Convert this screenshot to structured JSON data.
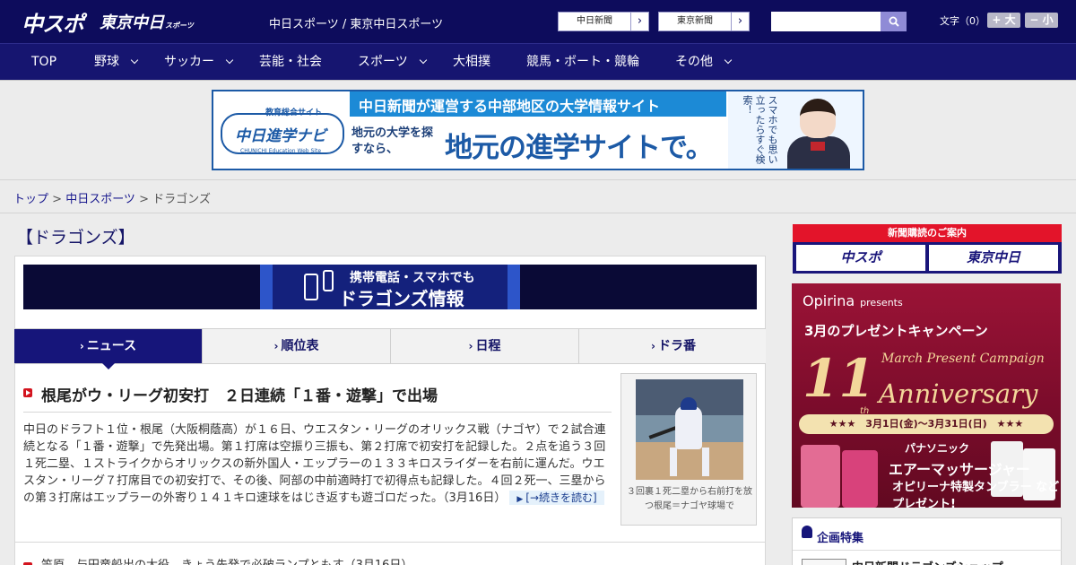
{
  "header": {
    "logo_main": "中スポ",
    "logo_tokyo": "東京中日",
    "logo_tokyo_sub": "スポーツ",
    "site_title": "中日スポーツ / 東京中日スポーツ",
    "links": [
      "中日新聞",
      "東京新聞"
    ],
    "link_arrow": "›",
    "search": {
      "placeholder": ""
    },
    "font_size": {
      "label": "文字（0）",
      "increase": "+ 大",
      "decrease": "− 小"
    }
  },
  "nav": {
    "items": [
      {
        "label": "TOP"
      },
      {
        "label": "野球"
      },
      {
        "label": "サッカー"
      },
      {
        "label": "芸能・社会"
      },
      {
        "label": "スポーツ"
      },
      {
        "label": "大相撲"
      },
      {
        "label": "競馬・ボート・競輪"
      },
      {
        "label": "その他"
      }
    ]
  },
  "ad_banner": {
    "logo_sub": "教育総合サイト",
    "logo_main": "中日進学ナビ",
    "logo_en": "CHUNICHI Education Web Site",
    "top": "中日新聞が運営する中部地区の大学情報サイト",
    "sub": "地元の大学を探すなら、",
    "main": "地元の進学サイトで。",
    "vertical": "スマホでも思い立ったらすぐ検索！"
  },
  "breadcrumb": {
    "home": "トップ",
    "section": "中日スポーツ",
    "current": "ドラゴンズ",
    "sep": " > "
  },
  "page": {
    "title": "【ドラゴンズ】"
  },
  "mobile_banner": {
    "line1": "携帯電話・スマホでも",
    "line2": "ドラゴンズ情報"
  },
  "tabs": [
    {
      "label": "ニュース",
      "active": true
    },
    {
      "label": "順位表"
    },
    {
      "label": "日程"
    },
    {
      "label": "ドラ番"
    }
  ],
  "tab_caret": "›",
  "article": {
    "headline": "根尾がウ・リーグ初安打　２日連続「１番・遊撃」で出場",
    "body": "中日のドラフト１位・根尾（大阪桐蔭高）が１６日、ウエスタン・リーグのオリックス戦（ナゴヤ）で２試合連続となる「１番・遊撃」で先発出場。第１打席は空振り三振も、第２打席で初安打を記録した。２点を追う３回１死二塁、１ストライクからオリックスの新外国人・エップラーの１３３キロスライダーを右前に運んだ。ウエスタン・リーグ７打席目での初安打で、その後、阿部の中前適時打で初得点も記録した。４回２死一、三塁からの第３打席はエップラーの外寄り１４１キロ速球をはじき返すも遊ゴロだった。",
    "date": "（3月16日）",
    "more": "[→続きを読む]",
    "photo_caption": "３回裏１死二塁から右前打を放つ根尾＝ナゴヤ球場で"
  },
  "news_list": [
    {
      "title": "笠原、与田竜船出の大役　きょう先発で必破ランプともす（3月16日）"
    }
  ],
  "sidebar": {
    "subscription": {
      "title": "新聞購読のご案内",
      "buttons": [
        "中スポ",
        "東京中日"
      ]
    },
    "campaign": {
      "brand": "Opirina",
      "presents": "presents",
      "line2": "3月のプレゼントキャンペーン",
      "en": "March Present Campaign",
      "number": "11",
      "th": "th",
      "anniversary": "Anniversary",
      "date": "★★★　3月1日(金)〜3月31日(日)　★★★",
      "p1": "パナソニック",
      "p2": "エアーマッサージャー",
      "p3": "オピリーナ特製タンブラー など プレゼント!"
    },
    "feature": {
      "title": "企画特集",
      "items": [
        "中日新聞ドラゴンズショップ"
      ]
    }
  },
  "colors": {
    "header_bg": "#0d0c5c",
    "nav_bg": "#161570",
    "accent_red": "#d3141e",
    "link_blue": "#1a1a8e"
  }
}
